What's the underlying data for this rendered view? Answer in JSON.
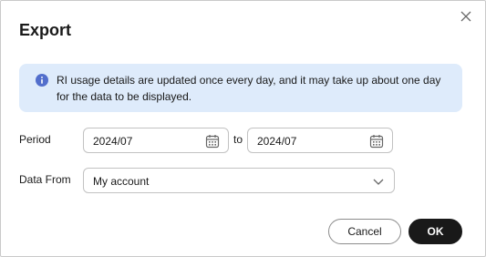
{
  "dialog": {
    "title": "Export",
    "close_icon": "close-icon"
  },
  "notice": {
    "icon": "info-icon",
    "text": "RI usage details are updated once every day, and it may take up about one day for the data to be displayed.",
    "color": "#deebfb"
  },
  "period": {
    "label": "Period",
    "start_value": "2024/07",
    "separator": "to",
    "end_value": "2024/07",
    "icon": "calendar-icon"
  },
  "data_from": {
    "label": "Data From",
    "selected": "My account",
    "icon": "chevron-down-icon"
  },
  "footer": {
    "cancel_label": "Cancel",
    "ok_label": "OK"
  },
  "colors": {
    "primary": "#191919",
    "info": "#526ecc"
  }
}
